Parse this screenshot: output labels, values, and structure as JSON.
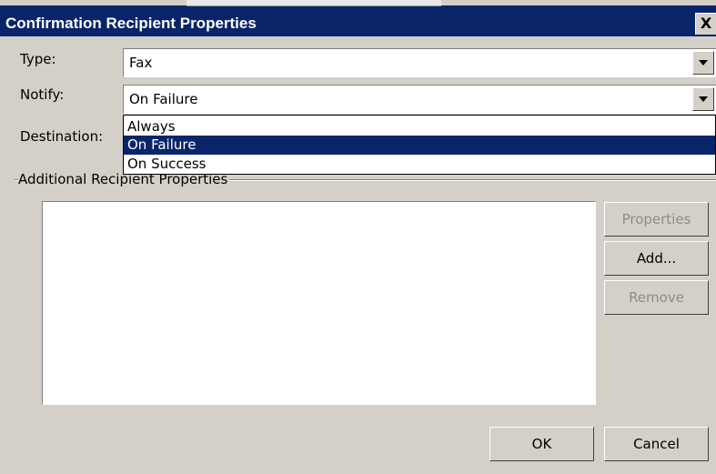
{
  "dialog": {
    "title": "Confirmation Recipient Properties",
    "close_label": "X"
  },
  "type_field": {
    "label": "Type:",
    "value": "Fax"
  },
  "notify_field": {
    "label": "Notify:",
    "value": "On Failure",
    "options": [
      "Always",
      "On Failure",
      "On Success"
    ],
    "highlighted_option": "On Failure"
  },
  "destination_field": {
    "label": "Destination:"
  },
  "additional": {
    "group_label": "Additional Recipient Properties",
    "buttons": {
      "properties": "Properties",
      "add": "Add...",
      "remove": "Remove"
    }
  },
  "footer": {
    "ok": "OK",
    "cancel": "Cancel"
  },
  "colors": {
    "titlebar": "#0a246a",
    "face": "#d4d0c8",
    "selection": "#0a246a"
  }
}
